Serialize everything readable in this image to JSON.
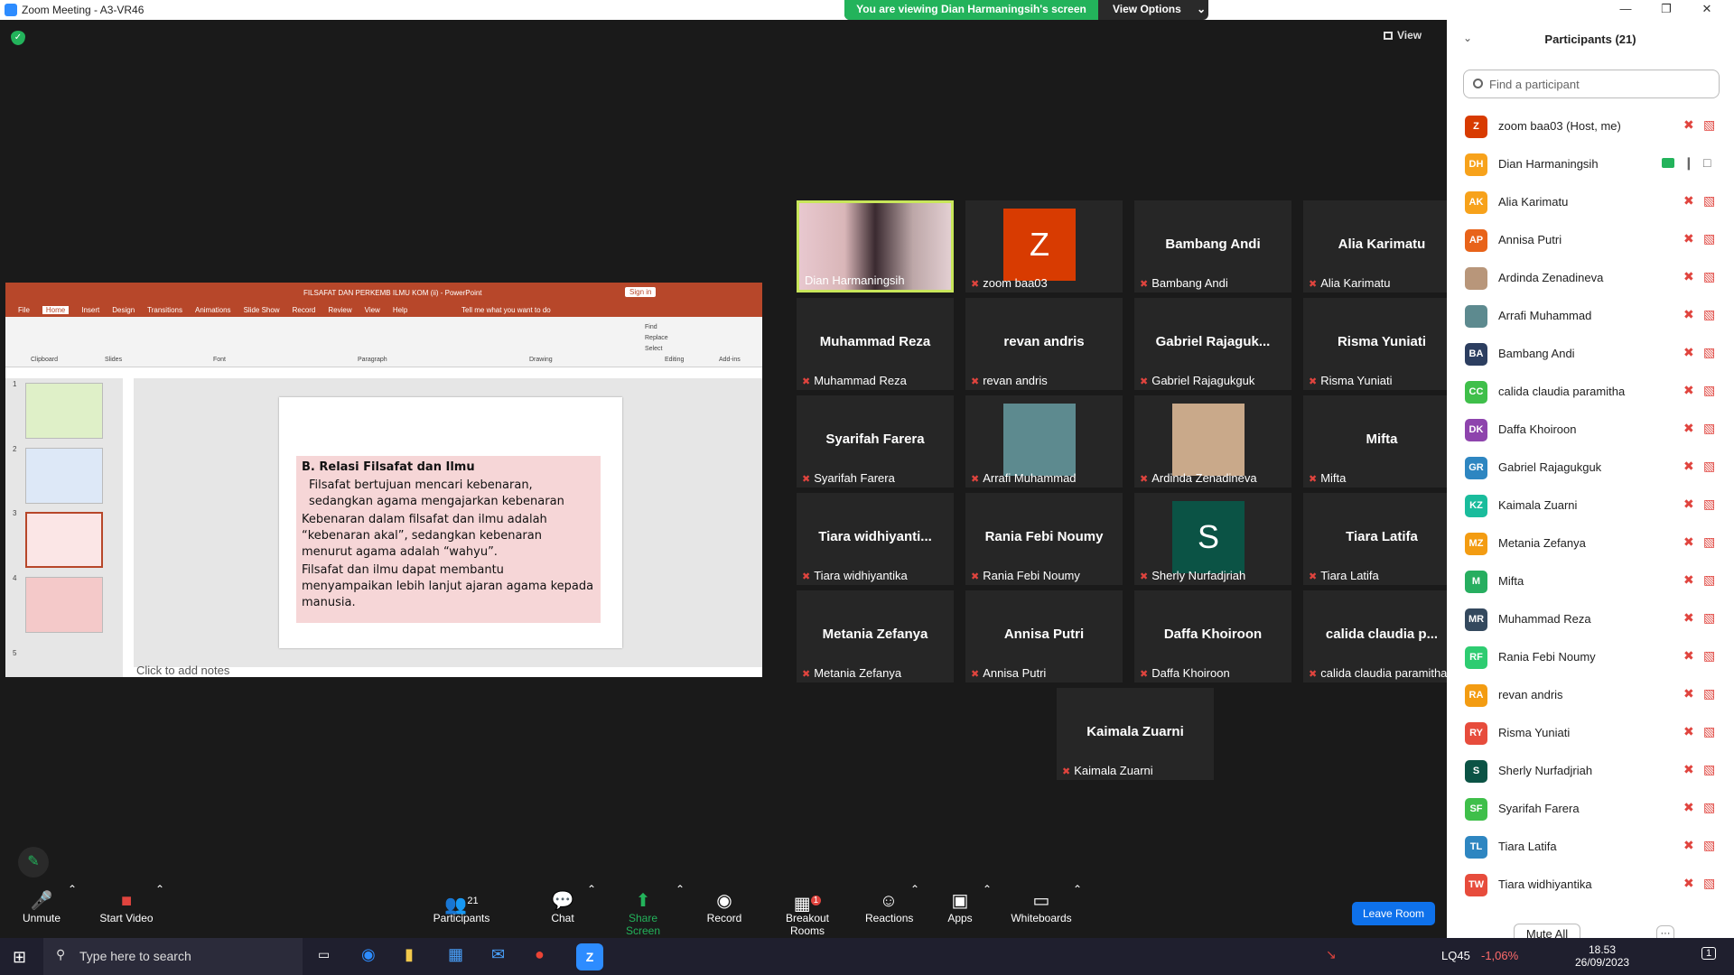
{
  "window": {
    "title": "Zoom Meeting - A3-VR46"
  },
  "banner": {
    "viewing": "You are viewing Dian Harmaningsih's screen",
    "options": "View Options"
  },
  "view_button": "View",
  "shared": {
    "ppt_title": "FILSAFAT DAN PERKEMB ILMU KOM (ii)  -  PowerPoint",
    "sign_in": "Sign in",
    "tabs": [
      "File",
      "Home",
      "Insert",
      "Design",
      "Transitions",
      "Animations",
      "Slide Show",
      "Record",
      "Review",
      "View",
      "Help"
    ],
    "tell_me": "Tell me what you want to do",
    "groups": [
      "Clipboard",
      "Slides",
      "Font",
      "Paragraph",
      "Drawing",
      "Editing",
      "Add-ins"
    ],
    "editing": [
      "Find",
      "Replace",
      "Select"
    ],
    "slide_heading": "B. Relasi Filsafat dan Ilmu",
    "slide_p1": "Filsafat bertujuan mencari kebenaran, sedangkan agama mengajarkan kebenaran",
    "slide_p2": "Kebenaran dalam filsafat dan ilmu adalah “kebenaran akal”, sedangkan kebenaran menurut agama adalah “wahyu”.",
    "slide_p3": "Filsafat dan ilmu dapat membantu menyampaikan lebih lanjut ajaran agama kepada manusia.",
    "notes_placeholder": "Click to add notes",
    "thumb_numbers": [
      "1",
      "2",
      "3",
      "4",
      "5"
    ]
  },
  "tiles": [
    {
      "big": "",
      "name": "Dian Harmaningsih",
      "speaking": true,
      "kind": "video"
    },
    {
      "big": "",
      "name": "zoom baa03",
      "kind": "avatar",
      "letter": "Z",
      "color": "#d83b01"
    },
    {
      "big": "Bambang Andi",
      "name": "Bambang Andi"
    },
    {
      "big": "Alia Karimatu",
      "name": "Alia Karimatu"
    },
    {
      "big": "Muhammad Reza",
      "name": "Muhammad Reza"
    },
    {
      "big": "revan andris",
      "name": "revan andris"
    },
    {
      "big": "Gabriel  Rajaguk...",
      "name": "Gabriel Rajagukguk"
    },
    {
      "big": "Risma Yuniati",
      "name": "Risma Yuniati"
    },
    {
      "big": "Syarifah Farera",
      "name": "Syarifah Farera"
    },
    {
      "big": "",
      "name": "Arrafi Muhammad",
      "kind": "photo",
      "color": "#5d8a8f"
    },
    {
      "big": "",
      "name": "Ardinda Zenadineva",
      "kind": "photo",
      "color": "#c9a98a"
    },
    {
      "big": "Mifta",
      "name": "Mifta"
    },
    {
      "big": "Tiara  widhiyanti...",
      "name": "Tiara widhiyantika"
    },
    {
      "big": "Rania Febi Noumy",
      "name": "Rania Febi Noumy"
    },
    {
      "big": "",
      "name": "Sherly Nurfadjriah",
      "kind": "avatar",
      "letter": "S",
      "color": "#0b5345"
    },
    {
      "big": "Tiara Latifa",
      "name": "Tiara Latifa"
    },
    {
      "big": "Metania Zefanya",
      "name": "Metania Zefanya"
    },
    {
      "big": "Annisa Putri",
      "name": "Annisa Putri"
    },
    {
      "big": "Daffa Khoiroon",
      "name": "Daffa Khoiroon"
    },
    {
      "big": "calida  claudia  p...",
      "name": "calida claudia paramitha"
    },
    {
      "big": "Kaimala Zuarni",
      "name": "Kaimala Zuarni"
    }
  ],
  "panel": {
    "title": "Participants (21)",
    "search_placeholder": "Find a participant",
    "mute_all": "Mute All",
    "more": "···",
    "participants": [
      {
        "initials": "Z",
        "name": "zoom baa03 (Host, me)",
        "color": "#d83b01"
      },
      {
        "initials": "DH",
        "name": "Dian Harmaningsih",
        "color": "#f7a21b",
        "sharing": true
      },
      {
        "initials": "AK",
        "name": "Alia Karimatu",
        "color": "#f7a21b"
      },
      {
        "initials": "AP",
        "name": "Annisa Putri",
        "color": "#e8631a"
      },
      {
        "initials": "",
        "name": "Ardinda Zenadineva",
        "color": "#b8967a",
        "photo": true
      },
      {
        "initials": "",
        "name": "Arrafi Muhammad",
        "color": "#5d8a8f",
        "photo": true
      },
      {
        "initials": "BA",
        "name": "Bambang Andi",
        "color": "#2c3e60"
      },
      {
        "initials": "CC",
        "name": "calida claudia paramitha",
        "color": "#3fbf4a"
      },
      {
        "initials": "DK",
        "name": "Daffa Khoiroon",
        "color": "#8e44ad"
      },
      {
        "initials": "GR",
        "name": "Gabriel Rajagukguk",
        "color": "#2e86c1"
      },
      {
        "initials": "KZ",
        "name": "Kaimala Zuarni",
        "color": "#1abc9c"
      },
      {
        "initials": "MZ",
        "name": "Metania Zefanya",
        "color": "#f39c12"
      },
      {
        "initials": "M",
        "name": "Mifta",
        "color": "#27ae60"
      },
      {
        "initials": "MR",
        "name": "Muhammad Reza",
        "color": "#34495e"
      },
      {
        "initials": "RF",
        "name": "Rania Febi Noumy",
        "color": "#2ecc71"
      },
      {
        "initials": "RA",
        "name": "revan andris",
        "color": "#f39c12"
      },
      {
        "initials": "RY",
        "name": "Risma Yuniati",
        "color": "#e74c3c"
      },
      {
        "initials": "S",
        "name": "Sherly Nurfadjriah",
        "color": "#0b5345"
      },
      {
        "initials": "SF",
        "name": "Syarifah Farera",
        "color": "#3fbf4a"
      },
      {
        "initials": "TL",
        "name": "Tiara Latifa",
        "color": "#2e86c1"
      },
      {
        "initials": "TW",
        "name": "Tiara widhiyantika",
        "color": "#e74c3c"
      }
    ]
  },
  "toolbar": {
    "unmute": "Unmute",
    "start_video": "Start Video",
    "participants": "Participants",
    "participants_count": "21",
    "chat": "Chat",
    "share_screen": "Share Screen",
    "record": "Record",
    "breakout_rooms": "Breakout Rooms",
    "breakout_badge": "1",
    "reactions": "Reactions",
    "apps": "Apps",
    "whiteboards": "Whiteboards",
    "leave_room": "Leave Room"
  },
  "taskbar": {
    "search_placeholder": "Type here to search",
    "stock": "LQ45",
    "stock_change": "-1,06%",
    "time": "18.53",
    "date": "26/09/2023",
    "notif_count": "1"
  }
}
